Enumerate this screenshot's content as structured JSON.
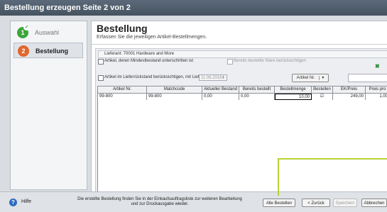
{
  "window": {
    "title": "Bestellung erzeugen Seite 2 von 2"
  },
  "sidebar": {
    "steps": [
      {
        "num": "1",
        "label": "Auswahl"
      },
      {
        "num": "2",
        "label": "Bestellung"
      }
    ]
  },
  "header": {
    "title": "Bestellung",
    "subtitle": "Erfassen Sie die jeweiligen Artikel-Bestellmengen."
  },
  "options": {
    "supplier": "Lieferant: 70001 Hardware and More",
    "min_stock": "Artikel, deren Mindestbestand unterschritten ist",
    "already_ordered": "Bereits bestellte Ware berücksichtigen",
    "backlog": "Artikel im Lieferrückstand berücksichtigen, mit Lieferdatum vor:",
    "date": "11.06.2016",
    "article_button": "Artikel Nr."
  },
  "table": {
    "columns": [
      "Artikel Nr.",
      "Matchcode",
      "Aktueller Bestand",
      "Bereits bestellt",
      "Bestellmenge",
      "Bestellen",
      "EK/Preis",
      "Preis pro"
    ],
    "rows": [
      {
        "artnr": "99-800",
        "match": "99-800",
        "bestand": "0,00",
        "bestellt": "0,00",
        "menge": "10,00",
        "bestellen": "☑",
        "preis": "249,00",
        "pro": "1,00"
      }
    ]
  },
  "footer": {
    "help": "Hilfe",
    "info_line1": "Die erstellte Bestellung finden Sie in der Einkaufsauftragsliste zur weiteren Bearbeitung",
    "info_line2": "und zur Druckausgabe wieder.",
    "buttons": {
      "all_orders": "Alle Bestellen",
      "back": "< Zurück",
      "save": "Speichern",
      "cancel": "Abbrechen"
    }
  },
  "colors": {
    "highlight": "#b5d334",
    "step_done": "#3ba53b",
    "step_active": "#e2652b"
  }
}
